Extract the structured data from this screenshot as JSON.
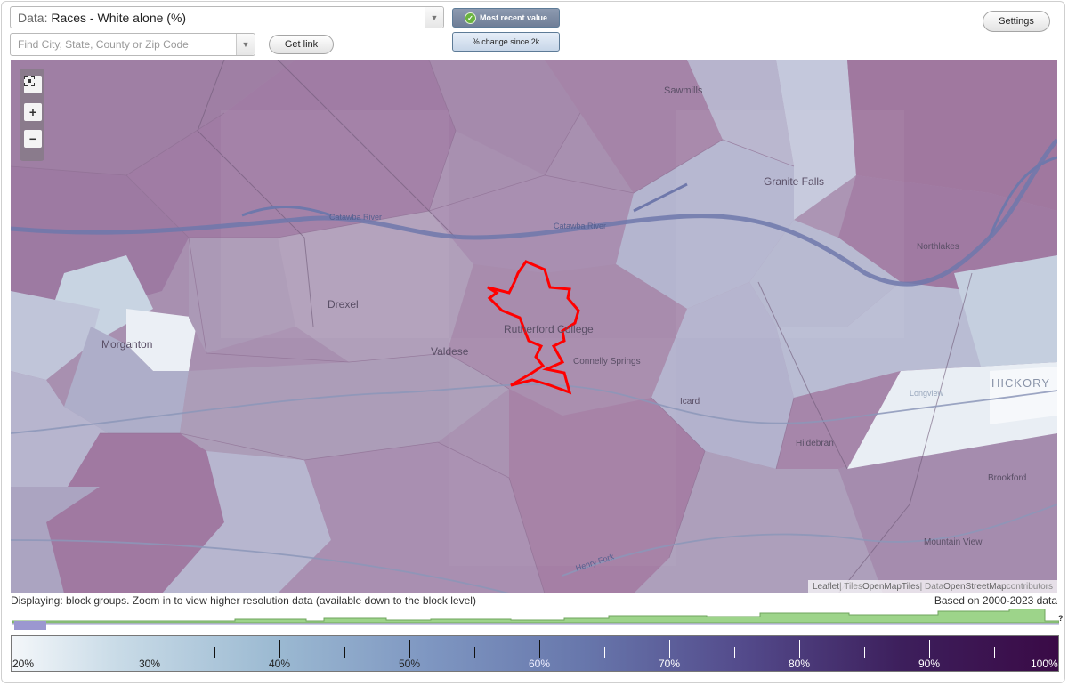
{
  "toolbar": {
    "data_prefix": "Data:",
    "data_value": "Races - White alone (%)",
    "search_placeholder": "Find City, State, County or Zip Code",
    "get_link_label": "Get link",
    "settings_label": "Settings",
    "mode_active_label": "Most recent value",
    "mode_alt_label": "% change since 2k"
  },
  "map": {
    "zoom_in": "+",
    "zoom_out": "−",
    "places": [
      {
        "name": "Sawmills"
      },
      {
        "name": "Granite Falls"
      },
      {
        "name": "Catawba River"
      },
      {
        "name": "Catawba River"
      },
      {
        "name": "Drexel"
      },
      {
        "name": "Morganton"
      },
      {
        "name": "Valdese"
      },
      {
        "name": "Rutherford College"
      },
      {
        "name": "Connelly Springs"
      },
      {
        "name": "Icard"
      },
      {
        "name": "Hildebran"
      },
      {
        "name": "Northlakes"
      },
      {
        "name": "Longview"
      },
      {
        "name": "HICKORY"
      },
      {
        "name": "Brookford"
      },
      {
        "name": "Mountain View"
      },
      {
        "name": "Henry Fork"
      }
    ],
    "attribution": {
      "leaflet": "Leaflet",
      "sep1": " | Tiles ",
      "tiles": "OpenMapTiles",
      "sep2": " | Data ",
      "data": "OpenStreetMap",
      "tail": " contributors"
    }
  },
  "status": {
    "displaying": "Displaying: block groups. Zoom in to view higher resolution data (available down to the block level)",
    "based_on": "Based on 2000-2023 data",
    "unknown_mark": "?"
  },
  "legend": {
    "labels": [
      "20%",
      "30%",
      "40%",
      "50%",
      "60%",
      "70%",
      "80%",
      "90%",
      "100%"
    ]
  },
  "colors": {
    "highlight_outline": "#ff0000",
    "histogram_fill": "#9dd48a",
    "histogram_selected": "#9b97d0"
  }
}
